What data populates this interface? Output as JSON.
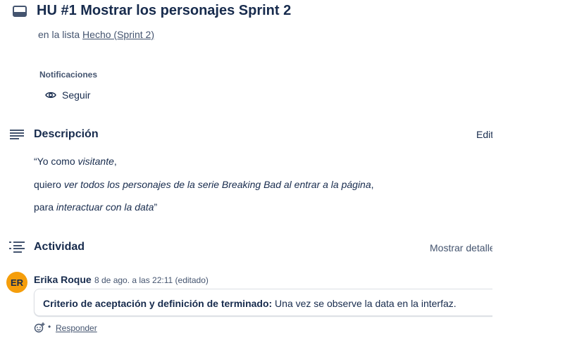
{
  "card": {
    "title": "HU #1 Mostrar los personajes Sprint 2",
    "list_prefix": "en la lista",
    "list_name": "Hecho (Sprint 2)"
  },
  "notifications": {
    "label": "Notificaciones",
    "follow_label": "Seguir"
  },
  "description": {
    "title": "Descripción",
    "edit_label": "Editar",
    "lines": [
      {
        "prefix": "“Yo como ",
        "italic": "visitante",
        "suffix": ","
      },
      {
        "prefix": "quiero ",
        "italic": "ver todos los personajes de la serie Breaking Bad al entrar a la página",
        "suffix": ","
      },
      {
        "prefix": "para ",
        "italic": "interactuar con la data",
        "suffix": "”"
      }
    ]
  },
  "activity": {
    "title": "Actividad",
    "show_details_label": "Mostrar detalles",
    "comments": [
      {
        "avatar_initials": "ER",
        "avatar_color": "#f59e0b",
        "author": "Erika Roque",
        "meta": "8 de ago. a las 22:11 (editado)",
        "bold": "Criterio de aceptación y definición de terminado:",
        "text": " Una vez se observe la data en la interfaz.",
        "separator": "•",
        "reply_label": "Responder"
      }
    ]
  }
}
